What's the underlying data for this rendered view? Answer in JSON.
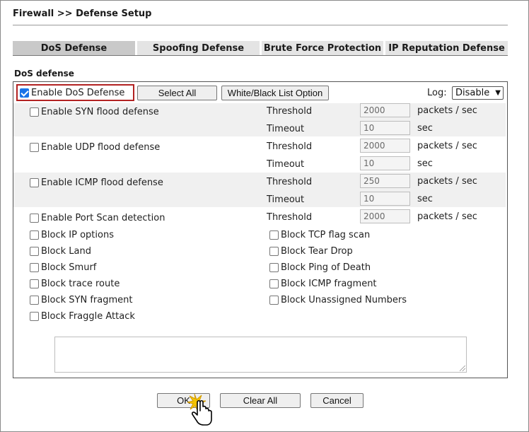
{
  "header": {
    "title": "Firewall >> Defense Setup"
  },
  "tabs": [
    {
      "label": "DoS Defense",
      "active": true
    },
    {
      "label": "Spoofing Defense",
      "active": false
    },
    {
      "label": "Brute Force Protection",
      "active": false
    },
    {
      "label": "IP Reputation Defense",
      "active": false
    }
  ],
  "section": {
    "title": "DoS defense"
  },
  "toolbar": {
    "enable_dos_label": "Enable DoS Defense",
    "enable_dos_checked": true,
    "select_all_label": "Select All",
    "wb_list_label": "White/Black List Option",
    "log_label": "Log:",
    "log_value": "Disable"
  },
  "flood": {
    "syn": {
      "label": "Enable SYN flood defense",
      "threshold_label": "Threshold",
      "threshold": "2000",
      "threshold_unit": "packets / sec",
      "timeout_label": "Timeout",
      "timeout": "10",
      "timeout_unit": "sec"
    },
    "udp": {
      "label": "Enable UDP flood defense",
      "threshold_label": "Threshold",
      "threshold": "2000",
      "threshold_unit": "packets / sec",
      "timeout_label": "Timeout",
      "timeout": "10",
      "timeout_unit": "sec"
    },
    "icmp": {
      "label": "Enable ICMP flood defense",
      "threshold_label": "Threshold",
      "threshold": "250",
      "threshold_unit": "packets / sec",
      "timeout_label": "Timeout",
      "timeout": "10",
      "timeout_unit": "sec"
    },
    "portscan": {
      "label": "Enable Port Scan detection",
      "threshold_label": "Threshold",
      "threshold": "2000",
      "threshold_unit": "packets / sec"
    }
  },
  "blocks": {
    "left": [
      "Block IP options",
      "Block Land",
      "Block Smurf",
      "Block trace route",
      "Block SYN fragment",
      "Block Fraggle Attack"
    ],
    "right": [
      "Block TCP flag scan",
      "Block Tear Drop",
      "Block Ping of Death",
      "Block ICMP fragment",
      "Block Unassigned Numbers"
    ]
  },
  "footer": {
    "ok_label": "OK",
    "clear_all_label": "Clear All",
    "cancel_label": "Cancel"
  },
  "colors": {
    "highlight": "#b22222",
    "active_tab": "#c9c9c9",
    "inactive_tab": "#e4e4e4",
    "checkbox_checked": "#1a73e8"
  },
  "icons": {
    "cursor": "hand-pointer-icon",
    "click_burst": "click-burst-icon"
  }
}
